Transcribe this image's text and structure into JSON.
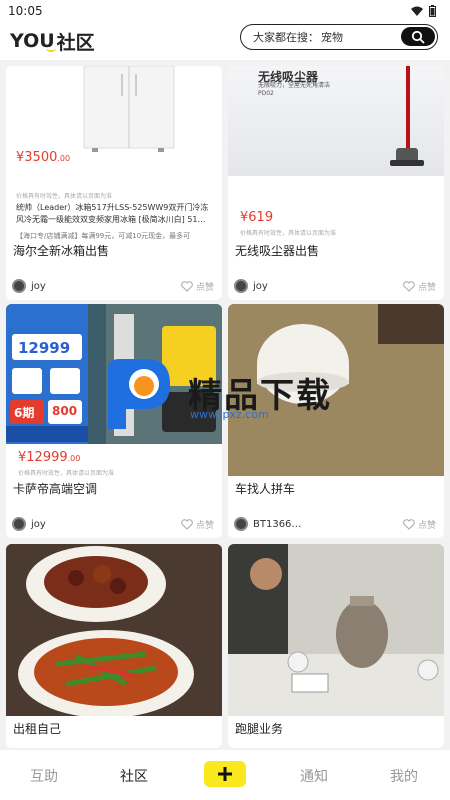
{
  "status_bar": {
    "time": "10:05"
  },
  "header": {
    "logo_you": "YOU",
    "logo_community": "社区",
    "search_label": "大家都在搜：",
    "search_keyword": "宠物"
  },
  "cards": [
    {
      "title": "海尔全新冰箱出售",
      "user": "joy",
      "like_label": "点赞",
      "price_main": "¥3500",
      "price_cents": ".00",
      "tiny_note": "价格具有时效性，具体请以页面为准",
      "desc": "统帅（Leader）冰箱517升LSS-525WW9双开门冷冻风冷无霜一级能效双变频家用冰箱 [极简冰川白] 51…",
      "promo": "【海口专/店铺满减】每满99元，可减10元现金，最多可"
    },
    {
      "title": "无线吸尘器出售",
      "user": "joy",
      "like_label": "点赞",
      "img_text_top": "无线吸尘器",
      "img_text_sub": "无限吸力，全屋无死角清洁",
      "img_model": "PD02",
      "price_main": "¥619",
      "tiny_note": "价格具有时效性，具体请以页面为准"
    },
    {
      "title": "卡萨帝高端空调",
      "user": "joy",
      "like_label": "点赞",
      "img_price": "12999",
      "img_periods": "6期",
      "img_amount": "800",
      "price_main": "¥12999",
      "price_cents": ".00",
      "tiny_note": "价格具有时效性，具体请以页面为准"
    },
    {
      "title": "车找人拼车",
      "user": "BT1366…",
      "like_label": "点赞"
    },
    {
      "title": "出租自己",
      "user": "",
      "like_label": ""
    },
    {
      "title": "跑腿业务",
      "user": "",
      "like_label": ""
    }
  ],
  "watermark": {
    "text": "精品下载",
    "url": "www.jpxz.com"
  },
  "bottom_nav": {
    "help": "互助",
    "community": "社区",
    "notify": "通知",
    "mine": "我的"
  },
  "colors": {
    "accent": "#f8e81c",
    "price": "#e53b2c"
  },
  "icons": [
    "wifi-icon",
    "battery-icon",
    "search-icon",
    "heart-icon",
    "plus-icon"
  ]
}
